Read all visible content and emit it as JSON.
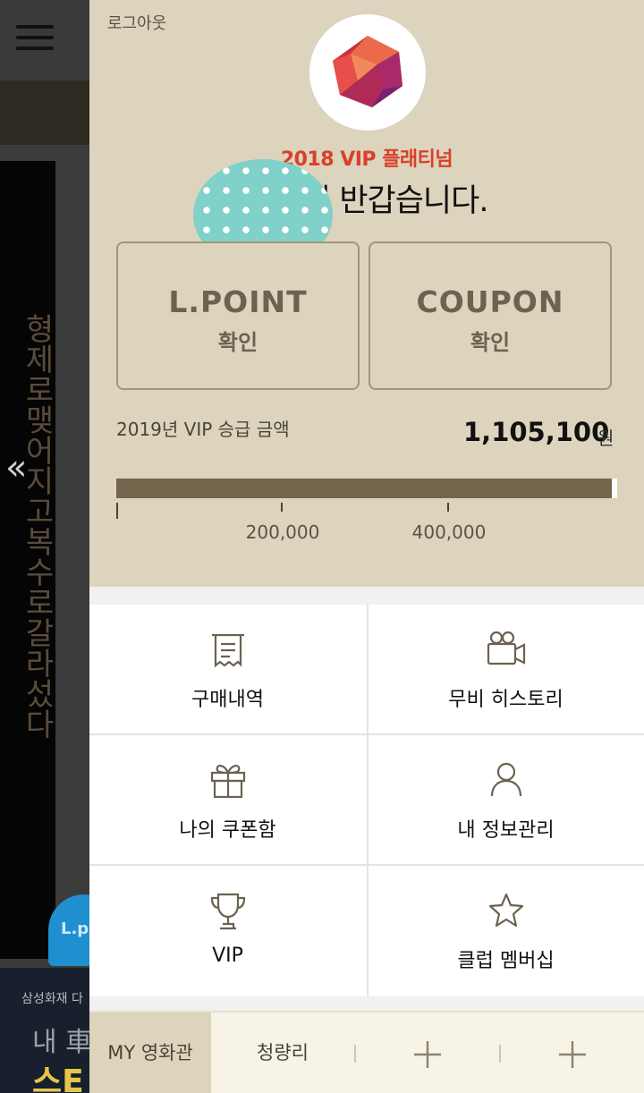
{
  "background": {
    "vertical_text": "형제로맺어지고복수로갈라섰다",
    "arrow_glyph": "«",
    "badge_text": "L.po",
    "banner_line1": "삼성화재 다",
    "banner_line2": "내 車",
    "banner_line3": "스E"
  },
  "drawer": {
    "logout_label": "로그아웃",
    "grade_label": "2018 VIP 플래티넘",
    "greeting": "님 반갑습니다.",
    "lpoint": {
      "title": "L.POINT",
      "action": "확인"
    },
    "coupon": {
      "title": "COUPON",
      "action": "확인"
    },
    "promotion": {
      "label": "2019년 VIP 승급 금액",
      "amount": "1,105,100",
      "unit": "원",
      "progress_fraction": 0.99,
      "ticks": [
        "200,000",
        "400,000"
      ]
    },
    "menu": [
      {
        "label": "구매내역",
        "icon": "receipt-icon"
      },
      {
        "label": "무비 히스토리",
        "icon": "movie-camera-icon"
      },
      {
        "label": "나의 쿠폰함",
        "icon": "gift-icon"
      },
      {
        "label": "내 정보관리",
        "icon": "person-icon"
      },
      {
        "label": "VIP",
        "icon": "trophy-icon"
      },
      {
        "label": "클럽 멤버십",
        "icon": "star-icon"
      }
    ],
    "tabs": {
      "my_cinema": "MY 영화관",
      "cinema_1": "청량리",
      "add_icon": "plus-icon"
    }
  },
  "colors": {
    "panel_bg": "#dcd4bc",
    "accent_red": "#d8402b",
    "bar_fill": "#74664d"
  }
}
